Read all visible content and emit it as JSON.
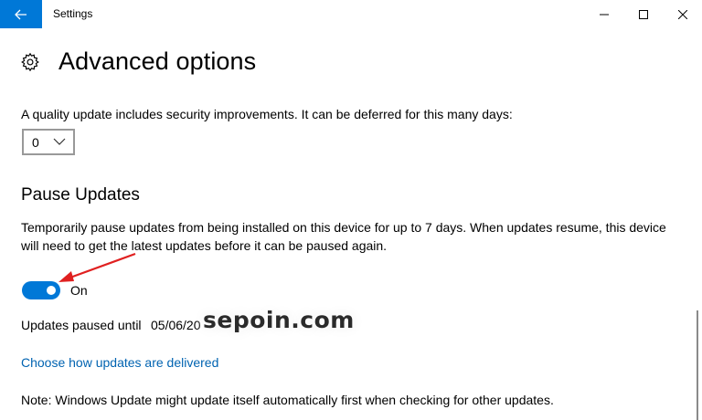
{
  "window": {
    "title": "Settings"
  },
  "page": {
    "title": "Advanced options"
  },
  "quality_update": {
    "description": "A quality update includes security improvements. It can be deferred for this many days:",
    "days_value": "0"
  },
  "pause_updates": {
    "title": "Pause Updates",
    "description_line1": "Temporarily pause updates from being installed on this device for up to 7 days. When updates resume, this device",
    "description_line2": "will need to get the latest updates before it can be paused again.",
    "toggle_state": "On",
    "paused_until_label": "Updates paused until",
    "paused_until_value": "05/06/20"
  },
  "links": {
    "delivery": "Choose how updates are delivered"
  },
  "note": "Note: Windows Update might update itself automatically first when checking for other updates.",
  "watermark": "sepoin.com",
  "colors": {
    "accent": "#0078d7",
    "link": "#0063b1",
    "annotation_arrow": "#e02020"
  },
  "icons": {
    "back": "back-arrow-icon",
    "settings": "gear-icon",
    "dropdown": "chevron-down-icon"
  }
}
